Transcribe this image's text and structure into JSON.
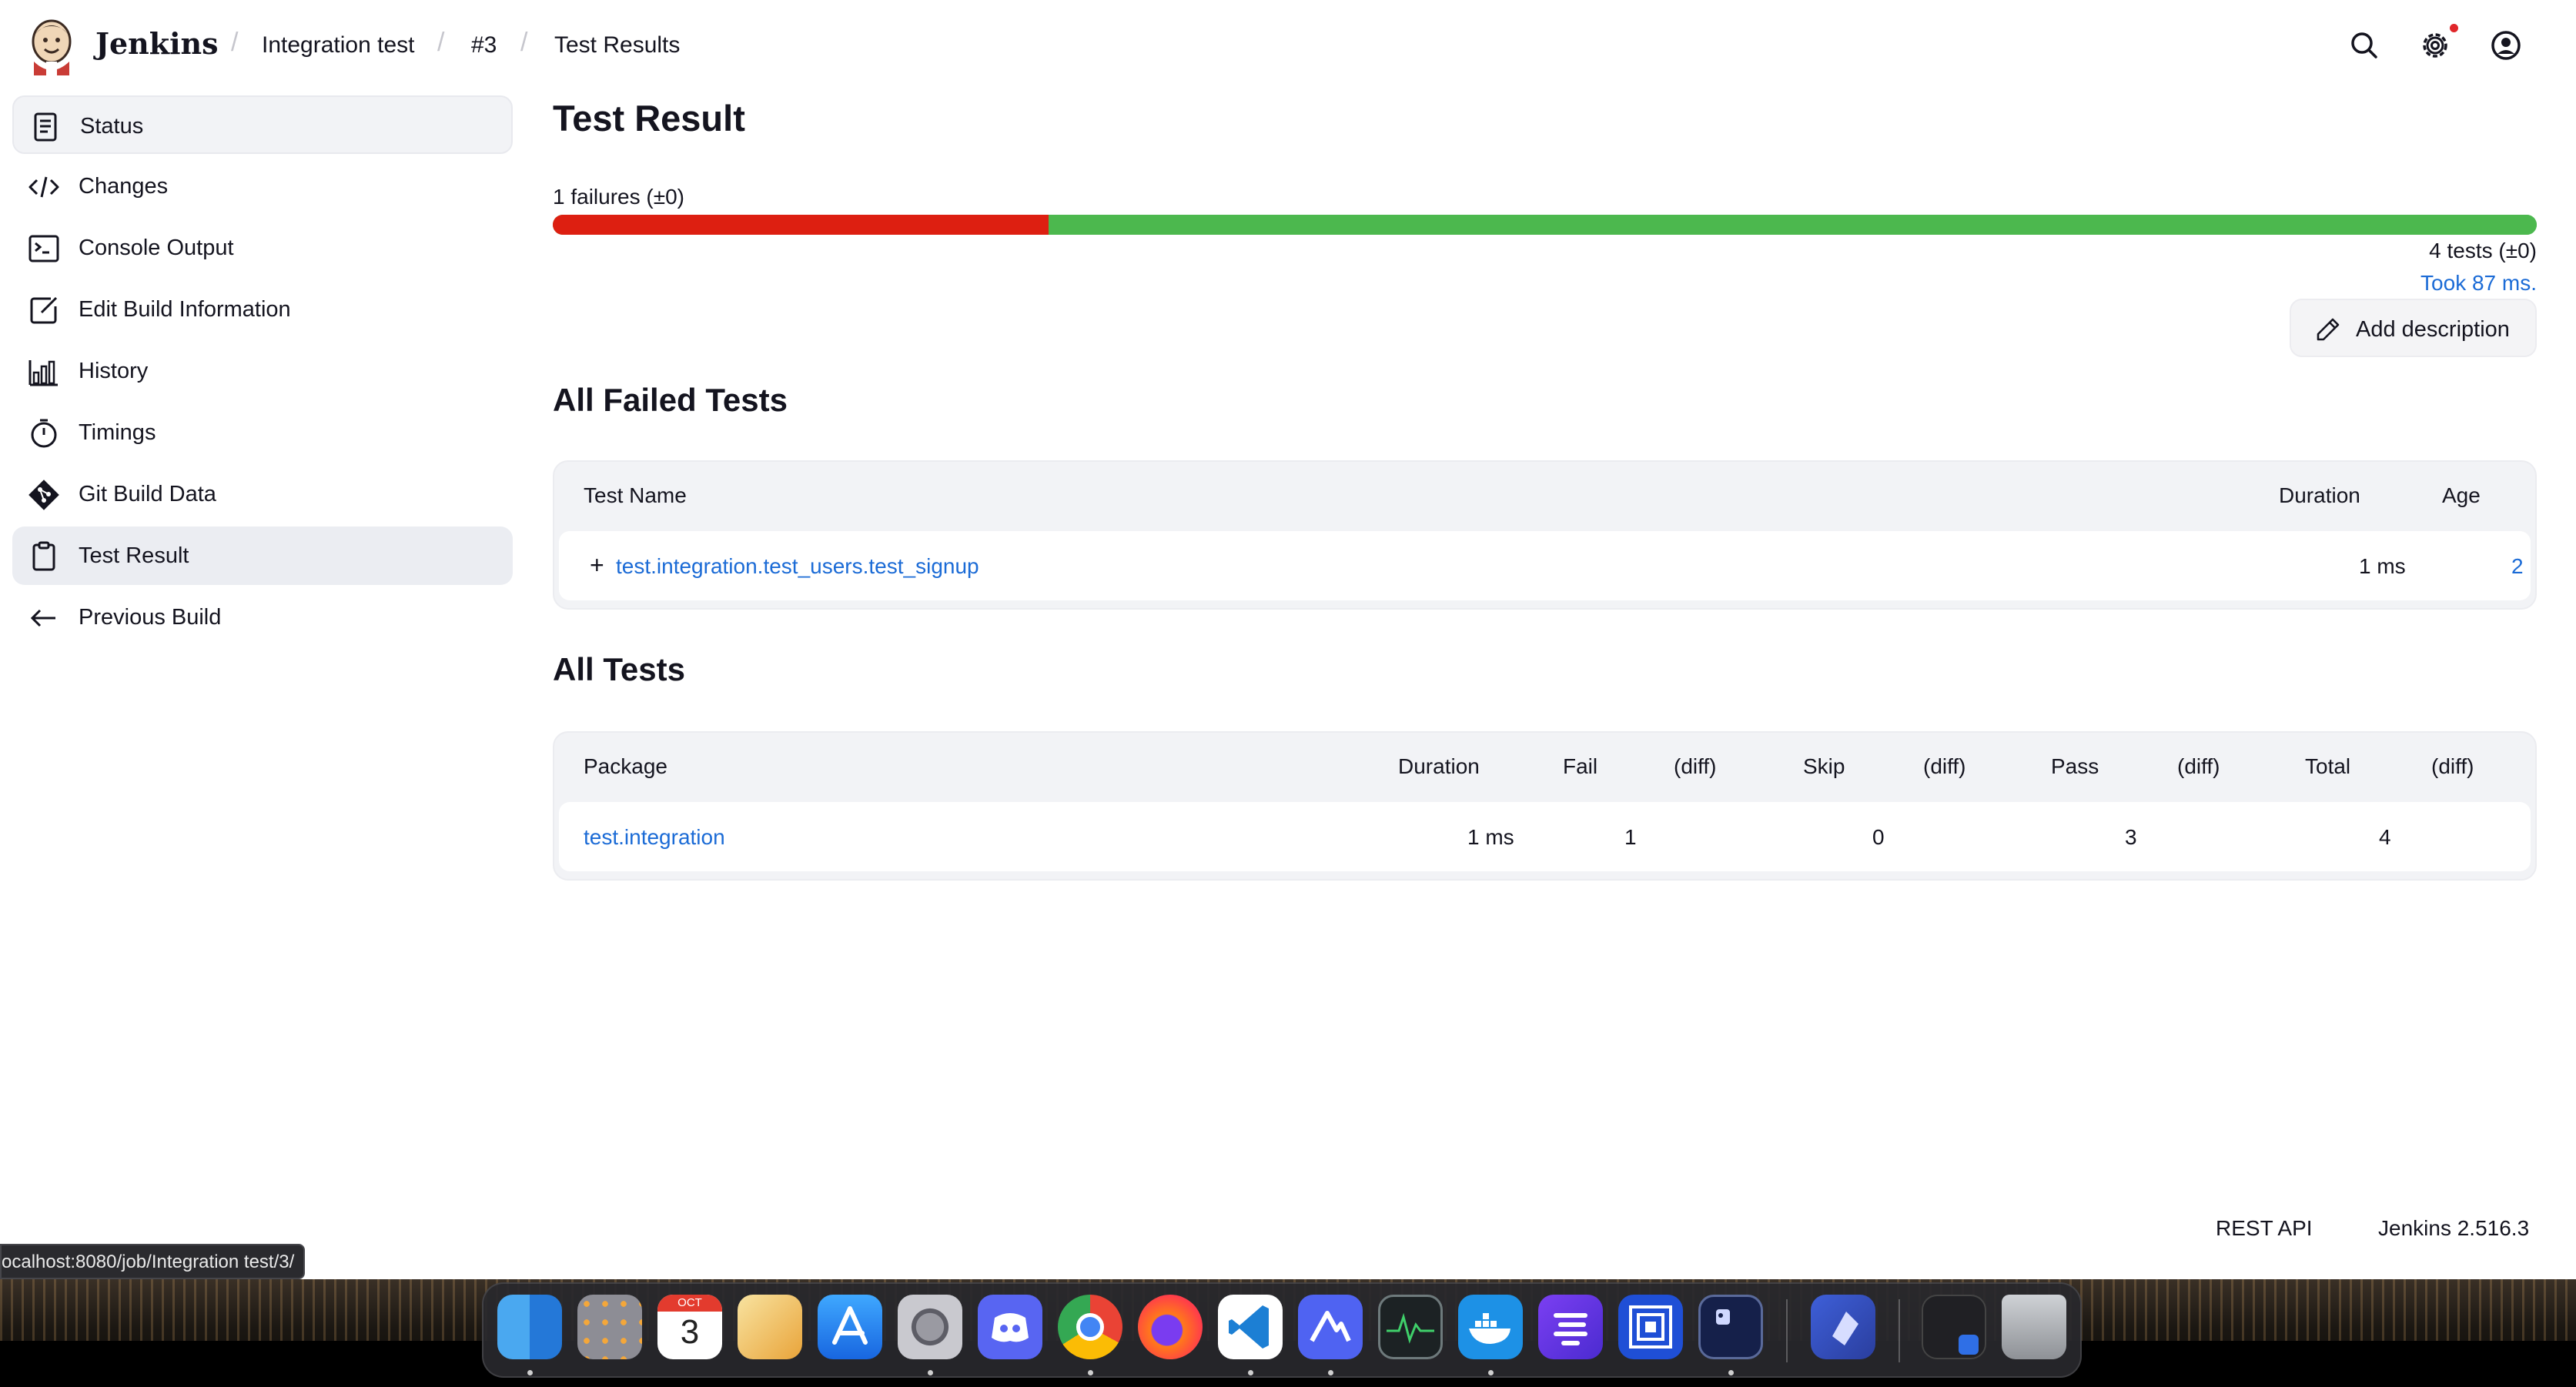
{
  "header": {
    "brand": "Jenkins",
    "breadcrumbs": [
      "Integration test",
      "#3",
      "Test Results"
    ]
  },
  "sidebar": {
    "items": [
      {
        "label": "Status",
        "icon": "document-icon"
      },
      {
        "label": "Changes",
        "icon": "code-icon"
      },
      {
        "label": "Console Output",
        "icon": "terminal-icon"
      },
      {
        "label": "Edit Build Information",
        "icon": "edit-icon"
      },
      {
        "label": "History",
        "icon": "bar-chart-icon"
      },
      {
        "label": "Timings",
        "icon": "stopwatch-icon"
      },
      {
        "label": "Git Build Data",
        "icon": "git-icon"
      },
      {
        "label": "Test Result",
        "icon": "clipboard-icon"
      },
      {
        "label": "Previous Build",
        "icon": "arrow-left-icon"
      }
    ],
    "active": "Test Result"
  },
  "main": {
    "title": "Test Result",
    "failures_label": "1 failures (±0)",
    "tests_label": "4 tests (±0)",
    "took_label": "Took 87 ms.",
    "add_description_label": "Add description",
    "progress": {
      "failed": 1,
      "total": 4,
      "fail_color": "#dd1f11",
      "pass_color": "#4cb84e"
    }
  },
  "failed_tests": {
    "title": "All Failed Tests",
    "headers": [
      "Test Name",
      "Duration",
      "Age"
    ],
    "rows": [
      {
        "name": "test.integration.test_users.test_signup",
        "duration": "1 ms",
        "age": "2"
      }
    ]
  },
  "all_tests": {
    "title": "All Tests",
    "headers": [
      "Package",
      "Duration",
      "Fail",
      "(diff)",
      "Skip",
      "(diff)",
      "Pass",
      "(diff)",
      "Total",
      "(diff)"
    ],
    "rows": [
      {
        "package": "test.integration",
        "duration": "1 ms",
        "fail": "1",
        "skip": "0",
        "pass": "3",
        "total": "4"
      }
    ]
  },
  "footer": {
    "rest_api": "REST API",
    "version": "Jenkins 2.516.3"
  },
  "status_bar": {
    "url": "ocalhost:8080/job/Integration test/3/"
  },
  "dock": {
    "calendar_month": "OCT",
    "calendar_day": "3",
    "apps": [
      "finder-icon",
      "launchpad-icon",
      "calendar-icon",
      "preview-icon",
      "app-store-icon",
      "system-settings-icon",
      "discord-icon",
      "chrome-icon",
      "firefox-icon",
      "vscode-icon",
      "nordvpn-icon",
      "activity-monitor-icon",
      "docker-icon",
      "linear-icon",
      "virtualbox-icon",
      "terminal-app-icon",
      "xcode-tool-icon",
      "window-thumbnail-icon",
      "trash-icon"
    ]
  }
}
